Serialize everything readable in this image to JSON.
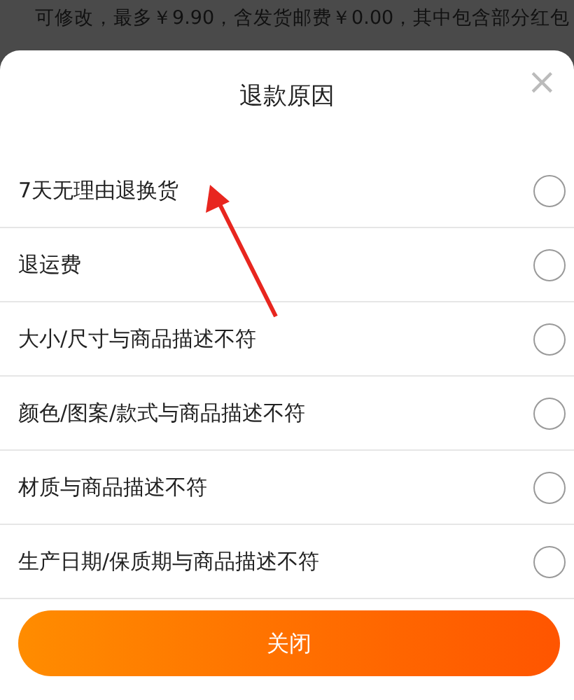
{
  "backdrop": {
    "text": "可修改，最多￥9.90，含发货邮费￥0.00，其中包含部分红包"
  },
  "sheet": {
    "title": "退款原因",
    "close_icon": "×"
  },
  "reasons": [
    {
      "label": "7天无理由退换货",
      "selected": false
    },
    {
      "label": "退运费",
      "selected": false
    },
    {
      "label": "大小/尺寸与商品描述不符",
      "selected": false
    },
    {
      "label": "颜色/图案/款式与商品描述不符",
      "selected": false
    },
    {
      "label": "材质与商品描述不符",
      "selected": false
    },
    {
      "label": "生产日期/保质期与商品描述不符",
      "selected": false
    }
  ],
  "close_button": {
    "label": "关闭"
  }
}
